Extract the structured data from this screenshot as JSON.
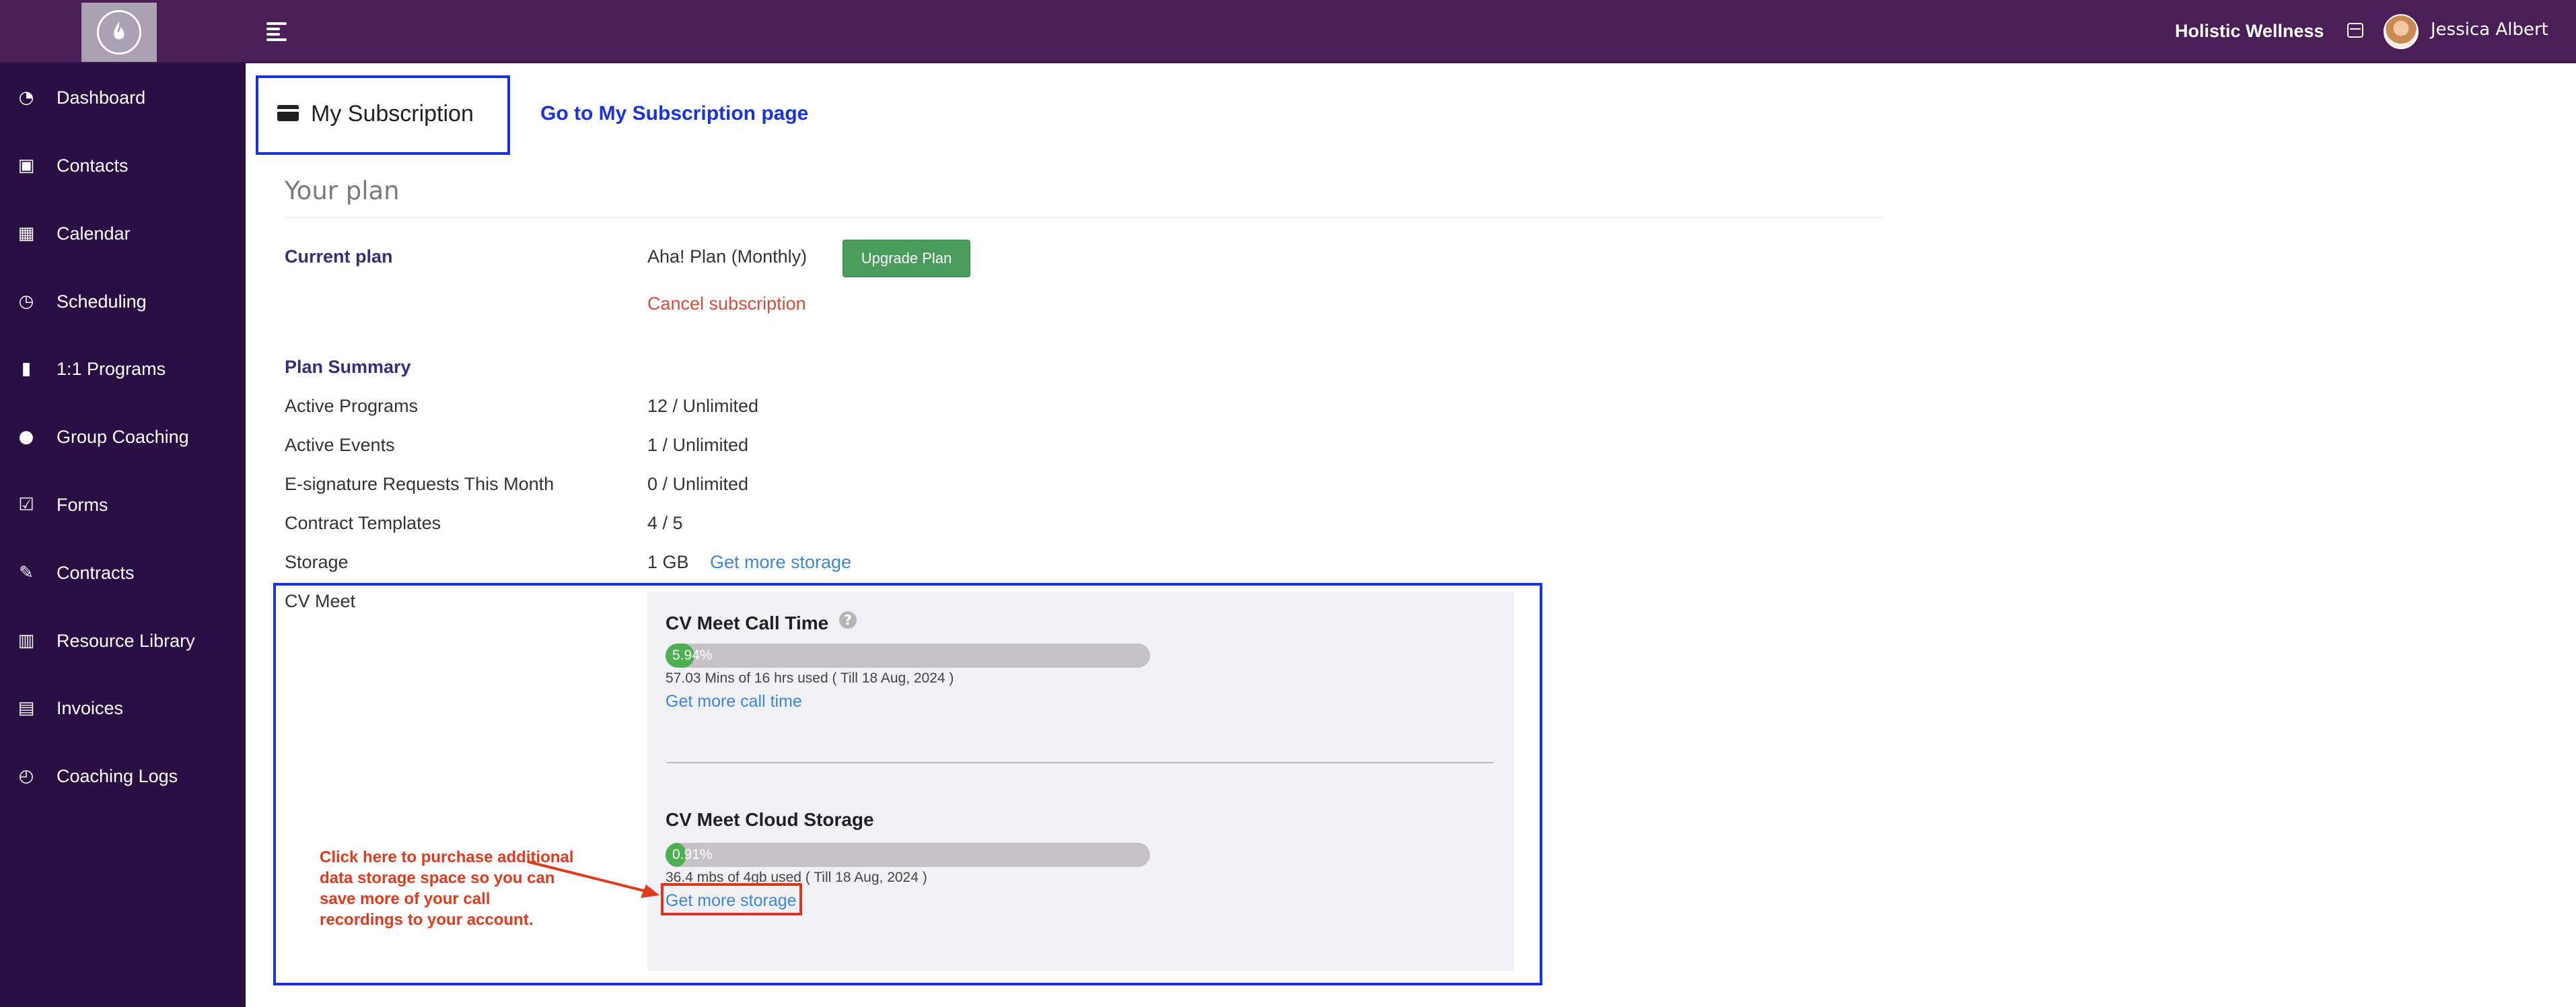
{
  "topbar": {
    "organization": "Holistic Wellness",
    "user_name": "Jessica Albert"
  },
  "sidebar": {
    "items": [
      {
        "label": "Dashboard",
        "icon": "dashboard-icon",
        "glyph": "◔"
      },
      {
        "label": "Contacts",
        "icon": "contacts-icon",
        "glyph": "▣"
      },
      {
        "label": "Calendar",
        "icon": "calendar-icon",
        "glyph": "▦"
      },
      {
        "label": "Scheduling",
        "icon": "scheduling-icon",
        "glyph": "◷"
      },
      {
        "label": "1:1 Programs",
        "icon": "book-icon",
        "glyph": "▮"
      },
      {
        "label": "Group Coaching",
        "icon": "group-icon",
        "glyph": "●"
      },
      {
        "label": "Forms",
        "icon": "forms-icon",
        "glyph": "☑"
      },
      {
        "label": "Contracts",
        "icon": "contracts-icon",
        "glyph": "✎"
      },
      {
        "label": "Resource Library",
        "icon": "library-icon",
        "glyph": "▥"
      },
      {
        "label": "Invoices",
        "icon": "invoices-icon",
        "glyph": "▤"
      },
      {
        "label": "Coaching Logs",
        "icon": "clock-icon",
        "glyph": "◴"
      }
    ]
  },
  "main": {
    "subscription_title": "My Subscription",
    "goto_link": "Go to My Subscription page",
    "your_plan": "Your plan",
    "current_plan_label": "Current plan",
    "current_plan_value": "Aha! Plan (Monthly)",
    "upgrade_button": "Upgrade Plan",
    "cancel_link": "Cancel subscription",
    "plan_summary_label": "Plan Summary",
    "summary": [
      {
        "label": "Active Programs",
        "value": "12 / Unlimited"
      },
      {
        "label": "Active Events",
        "value": "1 / Unlimited"
      },
      {
        "label": "E-signature Requests This Month",
        "value": "0 / Unlimited"
      },
      {
        "label": "Contract Templates",
        "value": "4 / 5"
      }
    ],
    "storage_label": "Storage",
    "storage_value": "1 GB",
    "storage_link": "Get more storage",
    "cv_meet_label": "CV Meet",
    "call_time": {
      "title": "CV Meet Call Time",
      "percent": 5.94,
      "percent_text": "5.94%",
      "usage": "57.03 Mins of 16 hrs used ( Till 18 Aug, 2024 )",
      "link": "Get more call time"
    },
    "cloud_storage": {
      "title": "CV Meet Cloud Storage",
      "percent": 0.91,
      "percent_text": "0.91%",
      "usage": "36.4 mbs of 4gb used ( Till 18 Aug, 2024 )",
      "link": "Get more storage"
    },
    "annotation": "Click here to purchase additional data storage space so you can save more of your call recordings to your account."
  },
  "colors": {
    "topbar": "#4a1f57",
    "sidebar": "#2a0f45",
    "highlight_blue": "#1933d9",
    "highlight_red": "#d9361f",
    "upgrade_green": "#4a9c5d",
    "progress_green": "#4caf50"
  }
}
